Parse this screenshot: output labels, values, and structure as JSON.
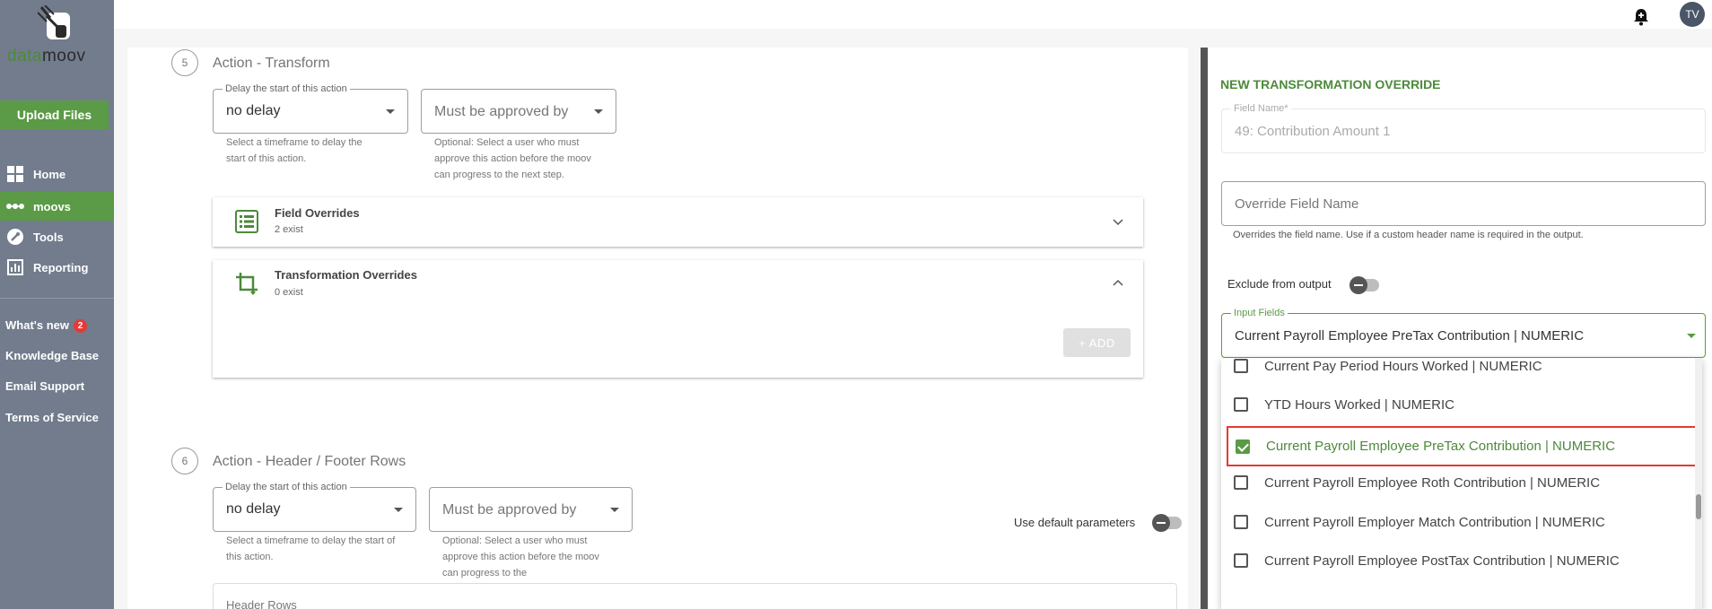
{
  "sidebar": {
    "logo": {
      "part1": "data",
      "part2": "moov"
    },
    "upload_label": "Upload Files",
    "nav": [
      {
        "label": "Home",
        "icon": "home-icon"
      },
      {
        "label": "moovs",
        "icon": "moovs-icon",
        "active": true
      },
      {
        "label": "Tools",
        "icon": "tools-icon"
      },
      {
        "label": "Reporting",
        "icon": "reporting-icon"
      }
    ],
    "links": {
      "whats_new": "What's new",
      "whats_new_badge": "2",
      "knowledge_base": "Knowledge Base",
      "email_support": "Email Support",
      "terms": "Terms of Service"
    }
  },
  "topbar": {
    "avatar_initials": "TV"
  },
  "step5": {
    "number": "5",
    "title": "Action - Transform",
    "delay": {
      "legend": "Delay the start of this action",
      "value": "no delay",
      "helper": "Select a timeframe to delay the start of this action."
    },
    "approval": {
      "placeholder": "Must be approved by",
      "helper": "Optional: Select a user who must approve this action before the moov can progress to the next step."
    },
    "field_overrides": {
      "title": "Field Overrides",
      "subtitle": "2 exist"
    },
    "transformation_overrides": {
      "title": "Transformation Overrides",
      "subtitle": "0 exist",
      "add_label": "+ ADD"
    }
  },
  "step6": {
    "number": "6",
    "title": "Action - Header / Footer Rows",
    "delay": {
      "legend": "Delay the start of this action",
      "value": "no delay",
      "helper": "Select a timeframe to delay the start of this action."
    },
    "approval": {
      "placeholder": "Must be approved by",
      "helper": "Optional: Select a user who must approve this action before the moov can progress to the"
    },
    "default_params_label": "Use default parameters",
    "header_rows_label": "Header Rows"
  },
  "panel": {
    "title": "NEW TRANSFORMATION OVERRIDE",
    "field_name": {
      "legend": "Field Name*",
      "value": "49: Contribution Amount 1"
    },
    "override_field": {
      "placeholder": "Override Field Name",
      "helper": "Overrides the field name. Use if a custom header name is required in the output."
    },
    "exclude_label": "Exclude from output",
    "input_fields": {
      "legend": "Input Fields",
      "value": "Current Payroll Employee PreTax Contribution | NUMERIC"
    },
    "options": [
      {
        "label": "Current Pay Period Hours Worked | NUMERIC",
        "checked": false
      },
      {
        "label": "YTD Hours Worked | NUMERIC",
        "checked": false
      },
      {
        "label": "Current Payroll Employee PreTax Contribution | NUMERIC",
        "checked": true
      },
      {
        "label": "Current Payroll Employee Roth Contribution | NUMERIC",
        "checked": false
      },
      {
        "label": "Current Payroll Employer Match Contribution | NUMERIC",
        "checked": false
      },
      {
        "label": "Current Payroll Employee PostTax Contribution | NUMERIC",
        "checked": false
      }
    ]
  },
  "colors": {
    "brand_green": "#5b9a46",
    "sidebar": "#727c8d",
    "highlight": "#e53935"
  }
}
